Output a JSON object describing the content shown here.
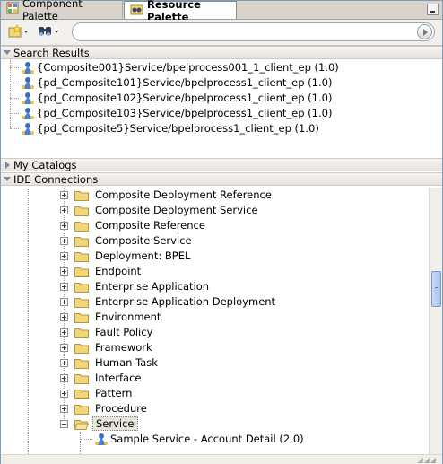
{
  "tabs": [
    {
      "label": "Component Palette",
      "icon": "grid-palette-icon"
    },
    {
      "label": "Resource Palette",
      "icon": "binoculars-folder-icon"
    }
  ],
  "toolbar": {
    "new_icon": "new-folder-star-icon",
    "search_icon": "binoculars-icon",
    "search_value": "",
    "go_icon": "go-arrow-icon"
  },
  "sections": {
    "search_results": "Search Results",
    "my_catalogs": "My Catalogs",
    "ide_connections": "IDE Connections"
  },
  "results": [
    "{Composite001}Service/bpelprocess001_1_client_ep (1.0)",
    "{pd_Composite101}Service/bpelprocess1_client_ep (1.0)",
    "{pd_Composite102}Service/bpelprocess1_client_ep (1.0)",
    "{pd_Composite103}Service/bpelprocess1_client_ep (1.0)",
    "{pd_Composite5}Service/bpelprocess1_client_ep (1.0)"
  ],
  "tree": [
    "Composite Deployment Reference",
    "Composite Deployment Service",
    "Composite Reference",
    "Composite Service",
    "Deployment: BPEL",
    "Endpoint",
    "Enterprise Application",
    "Enterprise Application Deployment",
    "Environment",
    "Fault Policy",
    "Framework",
    "Human Task",
    "Interface",
    "Pattern",
    "Procedure",
    "Service"
  ],
  "tree_selected": "Service",
  "service_children": [
    "Sample Service - Account Detail (2.0)"
  ],
  "colors": {
    "accent": "#7f9db9",
    "selection": "#e6e3dc",
    "folder": "#f3d67a"
  }
}
